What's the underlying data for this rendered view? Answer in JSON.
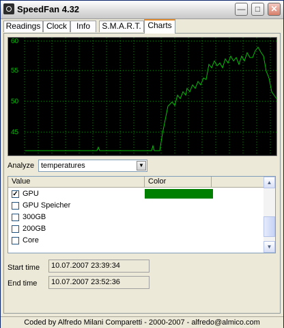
{
  "window": {
    "title": "SpeedFan 4.32"
  },
  "tabs": [
    "Readings",
    "Clock",
    "Info",
    "S.M.A.R.T.",
    "Charts"
  ],
  "active_tab": "Charts",
  "chart": {
    "y_ticks": [
      "60",
      "55",
      "50",
      "45"
    ],
    "line_color": "#00c000",
    "grid_color": "#00a000",
    "background": "#000000"
  },
  "analyze": {
    "label": "Analyze",
    "value": "temperatures"
  },
  "list": {
    "headers": [
      "Value",
      "Color"
    ],
    "rows": [
      {
        "label": "GPU",
        "checked": true,
        "color": "#008000"
      },
      {
        "label": "GPU Speicher",
        "checked": false
      },
      {
        "label": "300GB",
        "checked": false
      },
      {
        "label": "200GB",
        "checked": false
      },
      {
        "label": "Core",
        "checked": false
      }
    ]
  },
  "start_time": {
    "label": "Start time",
    "value": "10.07.2007 23:39:34"
  },
  "end_time": {
    "label": "End time",
    "value": "10.07.2007 23:52:36"
  },
  "status": "Coded by Alfredo Milani Comparetti - 2000-2007 - alfredo@almico.com"
}
